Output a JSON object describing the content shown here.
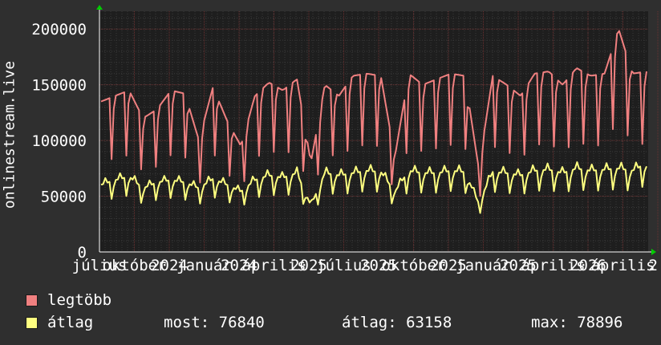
{
  "chart_data": {
    "type": "line",
    "ylabel": "onlinestream.live",
    "ylim": [
      0,
      216000
    ],
    "y_ticks": [
      0,
      50000,
      100000,
      150000,
      200000
    ],
    "y_tick_labels": [
      "0",
      "50000",
      "100000",
      "150000",
      "200000"
    ],
    "x_tick_labels": [
      "július",
      "október",
      "2024",
      "január",
      "2024",
      "április",
      "2025",
      "július",
      "2025",
      "október",
      "2025",
      "január",
      "2025",
      "április",
      "2026",
      "április",
      "2"
    ],
    "grid": true,
    "series": [
      {
        "name": "legtöbb",
        "color": "#f08080",
        "values": [
          135000,
          140000,
          145000,
          120000,
          128000,
          145000,
          142000,
          100000,
          148000,
          118000,
          95000,
          140000,
          152000,
          145000,
          155000,
          80000,
          150000,
          140000,
          158000,
          160000,
          158000,
          85000,
          160000,
          150000,
          155000,
          160000,
          158000,
          75000,
          158000,
          150000,
          140000,
          160000,
          162000,
          150000,
          165000,
          158000,
          160000,
          200000,
          160000,
          162000
        ]
      },
      {
        "name": "átlag",
        "color": "#ffff80",
        "values": [
          58000,
          62000,
          65000,
          55000,
          60000,
          62000,
          60000,
          55000,
          63000,
          58000,
          52000,
          62000,
          66000,
          64000,
          68000,
          40000,
          68000,
          66000,
          68000,
          70000,
          69000,
          52000,
          70000,
          68000,
          68000,
          70000,
          69000,
          42000,
          69000,
          68000,
          66000,
          70000,
          71000,
          68000,
          72000,
          70000,
          71000,
          72000,
          70000,
          76840
        ]
      }
    ]
  },
  "legend": {
    "max_label": "legtöbb",
    "avg_label": "átlag"
  },
  "stats": {
    "current": "most: 76840",
    "average": "átlag: 63158",
    "maximum": "max: 78896"
  },
  "colors": {
    "background": "#2f2f2f",
    "plot_background": "#1e1e1e",
    "grid_minor": "#3a3a3a",
    "grid_major": "#6a3030",
    "axis_arrow": "#00cc00"
  }
}
